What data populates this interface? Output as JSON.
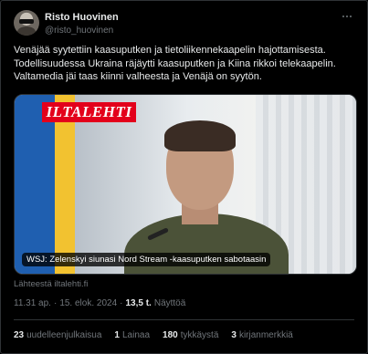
{
  "author": {
    "name": "Risto Huovinen",
    "handle": "@risto_huovinen"
  },
  "tweet": {
    "text": "Venäjää syytettiin kaasuputken ja tietoliikennekaapelin hajottamisesta. Todellisuudessa Ukraina räjäytti kaasuputken ja Kiina rikkoi telekaapelin. Valtamedia jäi taas kiinni valheesta ja Venäjä on syytön."
  },
  "card": {
    "logo_text": "ILTALEHTI",
    "caption": "WSJ: Zelenskyi siunasi Nord Stream -kaasuputken sabotaasin",
    "source": "Lähteestä iltalehti.fi"
  },
  "meta": {
    "time": "11.31 ap.",
    "separator": "·",
    "date": "15. elok. 2024",
    "views_count": "13,5 t.",
    "views_label": "Näyttöä"
  },
  "stats": {
    "reposts_count": "23",
    "reposts_label": "uudelleenjulkaisua",
    "quotes_count": "1",
    "quotes_label": "Lainaa",
    "likes_count": "180",
    "likes_label": "tykkäystä",
    "bookmarks_count": "3",
    "bookmarks_label": "kirjanmerkkiä"
  },
  "icons": {
    "more": "more-dots-icon"
  }
}
